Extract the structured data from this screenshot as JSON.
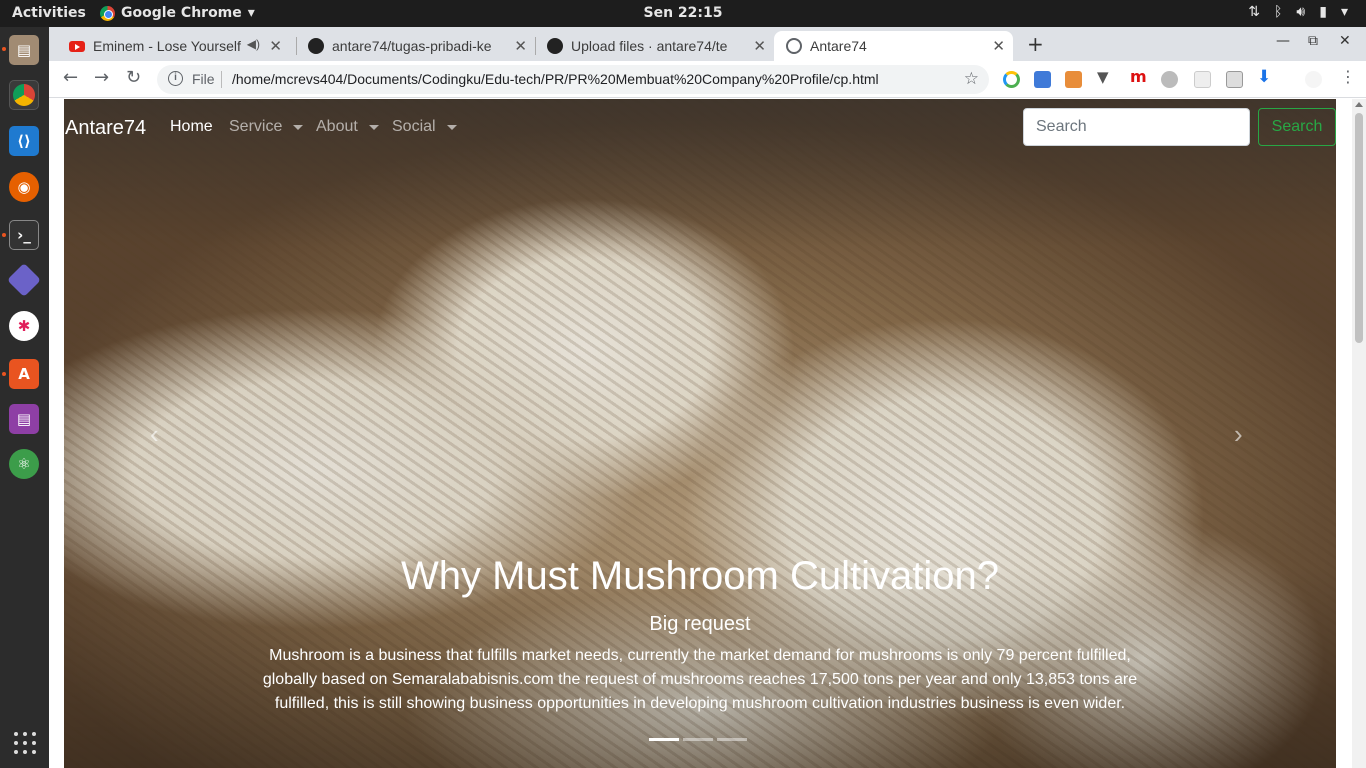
{
  "topbar": {
    "activities": "Activities",
    "app_menu": "Google Chrome",
    "clock": "Sen 22:15"
  },
  "dock": {
    "items": [
      "files-icon",
      "chrome-icon",
      "vscode-icon",
      "firefox-icon",
      "terminal-icon",
      "git-icon",
      "slack-icon",
      "software-center-icon",
      "libreoffice-base-icon",
      "atom-icon"
    ]
  },
  "chrome": {
    "tabs": [
      {
        "title": "Eminem - Lose Yourself",
        "favicon": "youtube-icon"
      },
      {
        "title": "antare74/tugas-pribadi-ke",
        "favicon": "github-icon"
      },
      {
        "title": "Upload files · antare74/te",
        "favicon": "github-icon"
      },
      {
        "title": "Antare74",
        "favicon": "globe-icon"
      }
    ],
    "address": {
      "scheme": "File",
      "url": "/home/mcrevs404/Documents/Codingku/Edu-tech/PR/PR%20Membuat%20Company%20Profile/cp.html"
    }
  },
  "site": {
    "brand": "Antare74",
    "nav": [
      {
        "label": "Home",
        "active": true
      },
      {
        "label": "Service",
        "dropdown": true
      },
      {
        "label": "About",
        "dropdown": true
      },
      {
        "label": "Social",
        "dropdown": true
      }
    ],
    "search_placeholder": "Search",
    "search_button": "Search",
    "slide": {
      "heading": "Why Must Mushroom Cultivation?",
      "subheading": "Big request",
      "text": "Mushroom is a business that fulfills market needs, currently the market demand for mushrooms is only 79 percent fulfilled, globally based on Semaralababisnis.com the request of mushrooms reaches 17,500 tons per year and only 13,853 tons are fulfilled, this is still showing business opportunities in developing mushroom cultivation industries business is even wider.",
      "indicator_count": 3,
      "active_index": 0
    }
  }
}
